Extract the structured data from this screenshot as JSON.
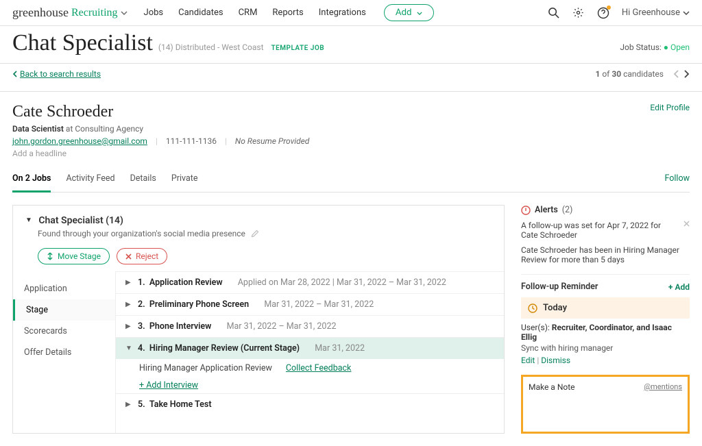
{
  "brand": {
    "g": "greenhouse",
    "r": "Recruiting"
  },
  "nav": {
    "items": [
      "Jobs",
      "Candidates",
      "CRM",
      "Reports",
      "Integrations"
    ],
    "add": "Add"
  },
  "user": {
    "greeting": "Hi Greenhouse"
  },
  "job": {
    "title": "Chat Specialist",
    "count": "(14)",
    "location": "Distributed - West Coast",
    "template_badge": "TEMPLATE JOB",
    "status_label": "Job Status:",
    "status_value": "Open"
  },
  "search": {
    "back": "Back to search results",
    "pos": "1",
    "of_word": "of",
    "total": "30",
    "what": "candidates"
  },
  "candidate": {
    "name": "Cate Schroeder",
    "role_title": "Data Scientist",
    "role_at": "at Consulting Agency",
    "email": "john.gordon.greenhouse@gmail.com",
    "phone": "111-111-1136",
    "no_resume": "No Resume Provided",
    "add_headline": "Add a headline",
    "edit_profile": "Edit Profile"
  },
  "tabs": {
    "items": [
      "On 2 Jobs",
      "Activity Feed",
      "Details",
      "Private"
    ],
    "follow": "Follow"
  },
  "panel": {
    "job_title": "Chat Specialist (14)",
    "found": "Found through your organization's social media presence",
    "move": "Move Stage",
    "reject": "Reject"
  },
  "stage_nav": [
    "Application",
    "Stage",
    "Scorecards",
    "Offer Details"
  ],
  "stages": [
    {
      "n": "1.",
      "name": "Application Review",
      "dates": "Applied on Mar 28, 2022 | Mar 31, 2022 – Mar 31, 2022"
    },
    {
      "n": "2.",
      "name": "Preliminary Phone Screen",
      "dates": "Mar 31, 2022 – Mar 31, 2022"
    },
    {
      "n": "3.",
      "name": "Phone Interview",
      "dates": "Mar 31, 2022 – Mar 31, 2022"
    },
    {
      "n": "4.",
      "name": "Hiring Manager Review (Current Stage)",
      "dates": "Mar 31, 2022",
      "current": true,
      "sub": {
        "label": "Hiring Manager Application Review",
        "collect": "Collect Feedback",
        "add": "+ Add Interview"
      }
    },
    {
      "n": "5.",
      "name": "Take Home Test",
      "dates": ""
    }
  ],
  "alerts": {
    "title": "Alerts",
    "count": "(2)",
    "items": [
      "A follow-up was set for Apr 7, 2022 for Cate Schroeder",
      "Cate Schroeder has been in Hiring Manager Review for more than 5 days"
    ]
  },
  "followup": {
    "title": "Follow-up Reminder",
    "add": "+ Add",
    "today": "Today",
    "users_label": "User(s):",
    "users": "Recruiter, Coordinator, and Isaac Ellig",
    "sync": "Sync with hiring manager",
    "edit": "Edit",
    "dismiss": "Dismiss"
  },
  "note": {
    "title": "Make a Note",
    "mentions": "@mentions"
  }
}
